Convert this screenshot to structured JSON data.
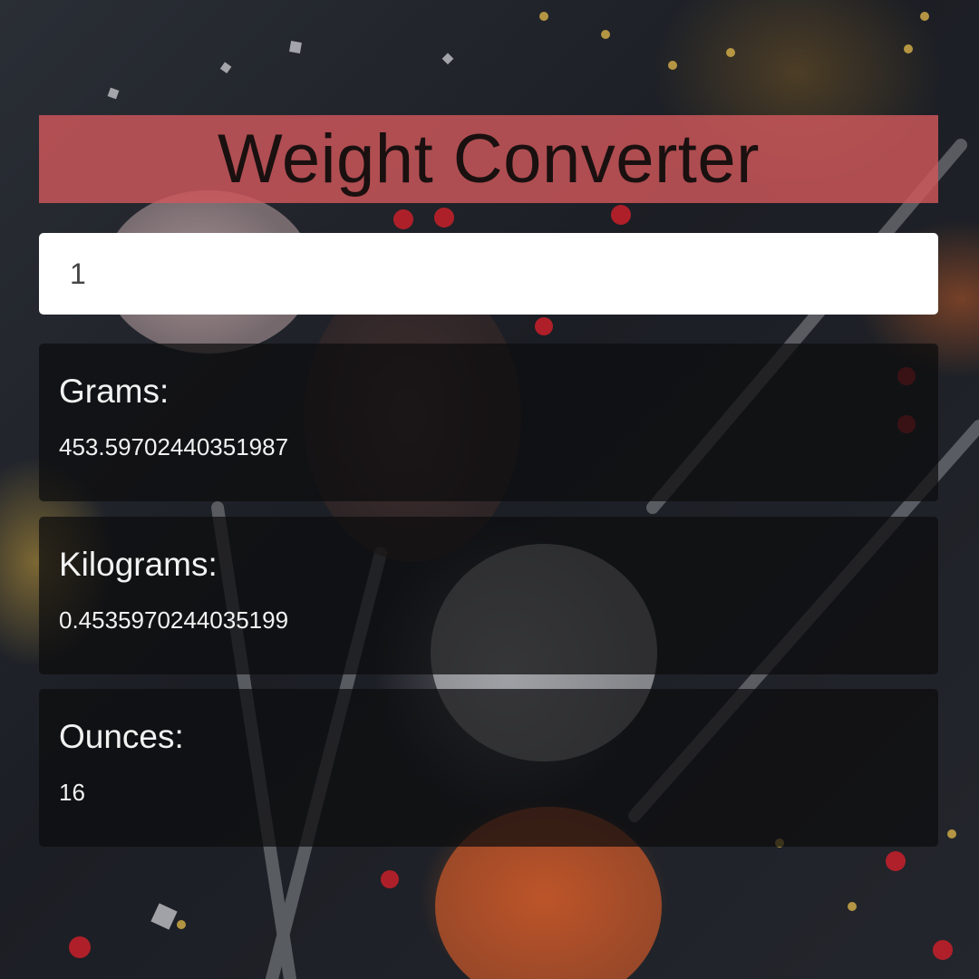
{
  "app": {
    "title": "Weight Converter"
  },
  "input": {
    "value": "1"
  },
  "results": {
    "grams": {
      "label": "Grams:",
      "value": "453.59702440351987"
    },
    "kilograms": {
      "label": "Kilograms:",
      "value": "0.4535970244035199"
    },
    "ounces": {
      "label": "Ounces:",
      "value": "16"
    }
  },
  "colors": {
    "title_bar": "#d0585c",
    "card_background": "#0c0c0e",
    "input_background": "#ffffff",
    "text_light": "#f2f2f2"
  }
}
